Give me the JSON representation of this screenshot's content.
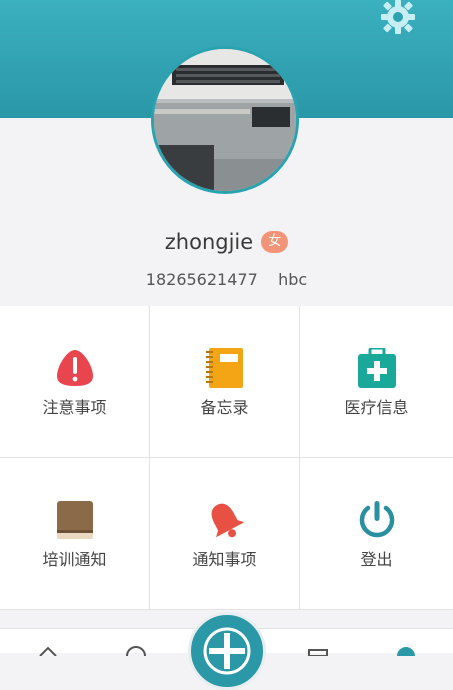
{
  "profile": {
    "username": "zhongjie",
    "gender": "女",
    "phone": "18265621477",
    "org": "hbc"
  },
  "menu": [
    {
      "label": "注意事项",
      "icon": "warning-icon",
      "color": "#e8454f"
    },
    {
      "label": "备忘录",
      "icon": "notebook-icon",
      "color": "#f3a516"
    },
    {
      "label": "医疗信息",
      "icon": "medical-kit-icon",
      "color": "#1aa89a"
    },
    {
      "label": "培训通知",
      "icon": "book-icon",
      "color": "#8b6a4a"
    },
    {
      "label": "通知事项",
      "icon": "bell-icon",
      "color": "#e85044"
    },
    {
      "label": "登出",
      "icon": "power-icon",
      "color": "#2a8fa0"
    }
  ],
  "colors": {
    "header": "#2fa2b2",
    "accent": "#2a98a6",
    "badge": "#f29477"
  }
}
